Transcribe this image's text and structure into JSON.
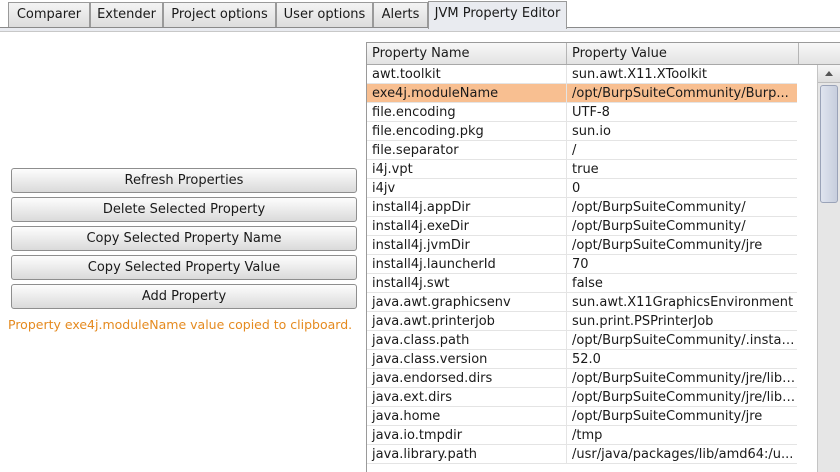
{
  "tabs": [
    {
      "label": "Comparer",
      "active": false
    },
    {
      "label": "Extender",
      "active": false
    },
    {
      "label": "Project options",
      "active": false
    },
    {
      "label": "User options",
      "active": false
    },
    {
      "label": "Alerts",
      "active": false
    },
    {
      "label": "JVM Property Editor",
      "active": true
    }
  ],
  "actions": {
    "refresh": "Refresh Properties",
    "delete": "Delete Selected Property",
    "copy_name": "Copy Selected Property Name",
    "copy_value": "Copy Selected Property Value",
    "add": "Add Property"
  },
  "status_message": "Property exe4j.moduleName value copied to clipboard.",
  "table": {
    "columns": [
      "Property Name",
      "Property Value"
    ],
    "selected_row": 1,
    "rows": [
      {
        "name": "awt.toolkit",
        "value": "sun.awt.X11.XToolkit"
      },
      {
        "name": "exe4j.moduleName",
        "value": "/opt/BurpSuiteCommunity/Burp..."
      },
      {
        "name": "file.encoding",
        "value": "UTF-8"
      },
      {
        "name": "file.encoding.pkg",
        "value": "sun.io"
      },
      {
        "name": "file.separator",
        "value": "/"
      },
      {
        "name": "i4j.vpt",
        "value": "true"
      },
      {
        "name": "i4jv",
        "value": "0"
      },
      {
        "name": "install4j.appDir",
        "value": "/opt/BurpSuiteCommunity/"
      },
      {
        "name": "install4j.exeDir",
        "value": "/opt/BurpSuiteCommunity/"
      },
      {
        "name": "install4j.jvmDir",
        "value": "/opt/BurpSuiteCommunity/jre"
      },
      {
        "name": "install4j.launcherId",
        "value": "70"
      },
      {
        "name": "install4j.swt",
        "value": "false"
      },
      {
        "name": "java.awt.graphicsenv",
        "value": "sun.awt.X11GraphicsEnvironment"
      },
      {
        "name": "java.awt.printerjob",
        "value": "sun.print.PSPrinterJob"
      },
      {
        "name": "java.class.path",
        "value": "/opt/BurpSuiteCommunity/.instal..."
      },
      {
        "name": "java.class.version",
        "value": "52.0"
      },
      {
        "name": "java.endorsed.dirs",
        "value": "/opt/BurpSuiteCommunity/jre/lib/..."
      },
      {
        "name": "java.ext.dirs",
        "value": "/opt/BurpSuiteCommunity/jre/lib/..."
      },
      {
        "name": "java.home",
        "value": "/opt/BurpSuiteCommunity/jre"
      },
      {
        "name": "java.io.tmpdir",
        "value": "/tmp"
      },
      {
        "name": "java.library.path",
        "value": "/usr/java/packages/lib/amd64:/u..."
      }
    ]
  },
  "icons": {
    "scroll_up": "chevron-up-icon"
  }
}
